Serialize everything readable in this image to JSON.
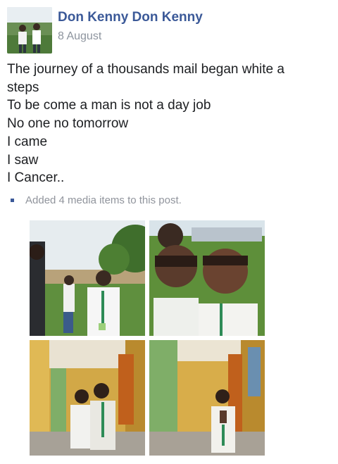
{
  "post": {
    "author": "Don Kenny Don Kenny",
    "date": "8 August",
    "lines": [
      "The journey of a thousands mail began white a",
      "steps",
      "To be come a man is not a day job",
      "No one no tomorrow",
      "I came",
      "I saw",
      "I Cancer.."
    ],
    "media_note": "Added 4 media items to this post."
  },
  "colors": {
    "author_link": "#3b5998",
    "meta_text": "#8d949e",
    "body_text": "#1c1e21"
  },
  "photos": [
    {
      "name": "photo-outdoor-boy"
    },
    {
      "name": "photo-two-selfie"
    },
    {
      "name": "photo-corridor-two"
    },
    {
      "name": "photo-corridor-one"
    }
  ]
}
